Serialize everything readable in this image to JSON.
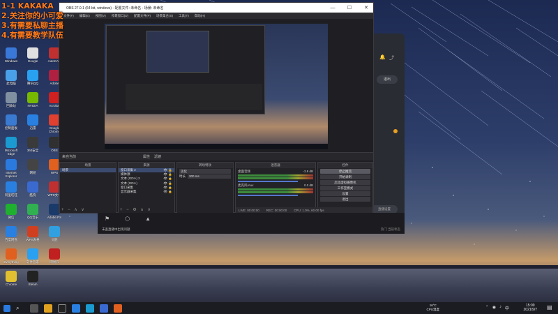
{
  "overlay_lines": [
    "1-1 KAKAKA",
    "2.关注你的小可爱",
    "3.有需要私聊主播",
    "4.有需要教学队伍"
  ],
  "desktop_icons": [
    {
      "label": "Windows",
      "color": "#3a78d8"
    },
    {
      "label": "Google",
      "color": "#e0e0e0"
    },
    {
      "label": "AutoCAD",
      "color": "#c03030"
    },
    {
      "label": "此电脑",
      "color": "#4aa0e8"
    },
    {
      "label": "腾讯QQ",
      "color": "#2aa0f0"
    },
    {
      "label": "Adobe",
      "color": "#b02040"
    },
    {
      "label": "回收站",
      "color": "#8090a0"
    },
    {
      "label": "NVIDIA",
      "color": "#76b900"
    },
    {
      "label": "Acrobat",
      "color": "#d02020"
    },
    {
      "label": "控制面板",
      "color": "#3a7ad0"
    },
    {
      "label": "迅雷",
      "color": "#2a80e0"
    },
    {
      "label": "Google Chrome",
      "color": "#e04030"
    },
    {
      "label": "Microsoft Edge",
      "color": "#1a9ad0"
    },
    {
      "label": "360安全",
      "color": "#3a3a3a"
    },
    {
      "label": "OBS",
      "color": "#303030"
    },
    {
      "label": "Internet Explorer",
      "color": "#2a7ae0"
    },
    {
      "label": "网易",
      "color": "#444"
    },
    {
      "label": "WPS",
      "color": "#e06020"
    },
    {
      "label": "阿里旺旺",
      "color": "#2a80e0"
    },
    {
      "label": "酷狗",
      "color": "#3a6ad0"
    },
    {
      "label": "WPS文档",
      "color": "#c03030"
    },
    {
      "label": "微信",
      "color": "#20b030"
    },
    {
      "label": "QQ音乐",
      "color": "#30b050"
    },
    {
      "label": "Adobe PS",
      "color": "#1a3a6a"
    },
    {
      "label": "百度网盘",
      "color": "#2a80e0"
    },
    {
      "label": "WPS表格",
      "color": "#d04020"
    },
    {
      "label": "优酷",
      "color": "#30a0e0"
    },
    {
      "label": "Everything",
      "color": "#e06020"
    },
    {
      "label": "软件管家",
      "color": "#2aa0f0"
    },
    {
      "label": "网易云",
      "color": "#c02020"
    },
    {
      "label": "Chrome",
      "color": "#e0c030"
    },
    {
      "label": "Steam",
      "color": "#222"
    }
  ],
  "obs": {
    "title": "OBS 27.0.1 (64-bit, windows) - 配置文件: 未命名 - 场景: 未命名",
    "menus": [
      "文件(F)",
      "编辑(E)",
      "视图(V)",
      "停靠窗口(D)",
      "配置文件(P)",
      "场景集合(S)",
      "工具(T)",
      "帮助(H)"
    ],
    "controls_row": [
      "来自当前",
      "属性",
      "滤镜"
    ],
    "docks": {
      "scenes": {
        "title": "场景",
        "items": [
          "场景"
        ]
      },
      "sources": {
        "title": "来源",
        "items": [
          "窗口采集 2",
          "媒体源",
          "文本 (GDI+) 2",
          "文本 (GDI+)",
          "窗口采集",
          "显示器采集"
        ]
      },
      "transitions": {
        "title": "转场特效",
        "type": "淡化",
        "duration_label": "时长",
        "duration": "300 ms"
      },
      "mixer": {
        "title": "混音器",
        "channels": [
          {
            "name": "桌面音频",
            "level": "-3.8 dB"
          },
          {
            "name": "麦克风/Aux",
            "level": "0.0 dB"
          }
        ]
      },
      "controls": {
        "title": "控件",
        "buttons": [
          "停止推流",
          "开始录制",
          "启动虚拟摄像机",
          "工作室模式",
          "设置",
          "退出"
        ]
      }
    },
    "status": [
      "LIVE: 00:00:00",
      "REC: 00:00:00",
      "CPU: 1.0%, 60.00 fps"
    ]
  },
  "right_app": {
    "logout": "退出",
    "settings": "直播设置"
  },
  "livebar": {
    "left": "未查直播中出现问题",
    "right": "热门 当前状态"
  },
  "taskbar": {
    "weather_temp": "16°C",
    "weather_text": "CPU温度",
    "time": "15:09",
    "date": "2021/9/7"
  }
}
